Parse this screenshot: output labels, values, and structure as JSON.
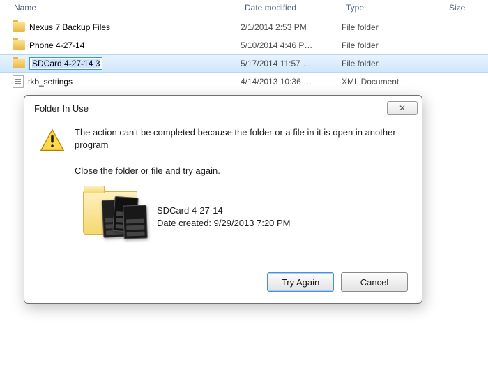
{
  "columns": {
    "name": "Name",
    "date": "Date modified",
    "type": "Type",
    "size": "Size"
  },
  "rows": [
    {
      "name": "Nexus 7 Backup Files",
      "date": "2/1/2014 2:53 PM",
      "type": "File folder",
      "kind": "folder",
      "selected": false,
      "renaming": false
    },
    {
      "name": "Phone 4-27-14",
      "date": "5/10/2014 4:46 P…",
      "type": "File folder",
      "kind": "folder",
      "selected": false,
      "renaming": false
    },
    {
      "name": "SDCard 4-27-14 3",
      "date": "5/17/2014 11:57 …",
      "type": "File folder",
      "kind": "folder",
      "selected": true,
      "renaming": true
    },
    {
      "name": "tkb_settings",
      "date": "4/14/2013 10:36 …",
      "type": "XML Document",
      "kind": "file",
      "selected": false,
      "renaming": false
    }
  ],
  "dialog": {
    "title": "Folder In Use",
    "message": "The action can't be completed because the folder or a file in it is open in another program",
    "sub": "Close the folder or file and try again.",
    "folder_name": "SDCard 4-27-14",
    "folder_created_label": "Date created: 9/29/2013 7:20 PM",
    "try_again": "Try Again",
    "cancel": "Cancel",
    "close_glyph": "✕"
  }
}
